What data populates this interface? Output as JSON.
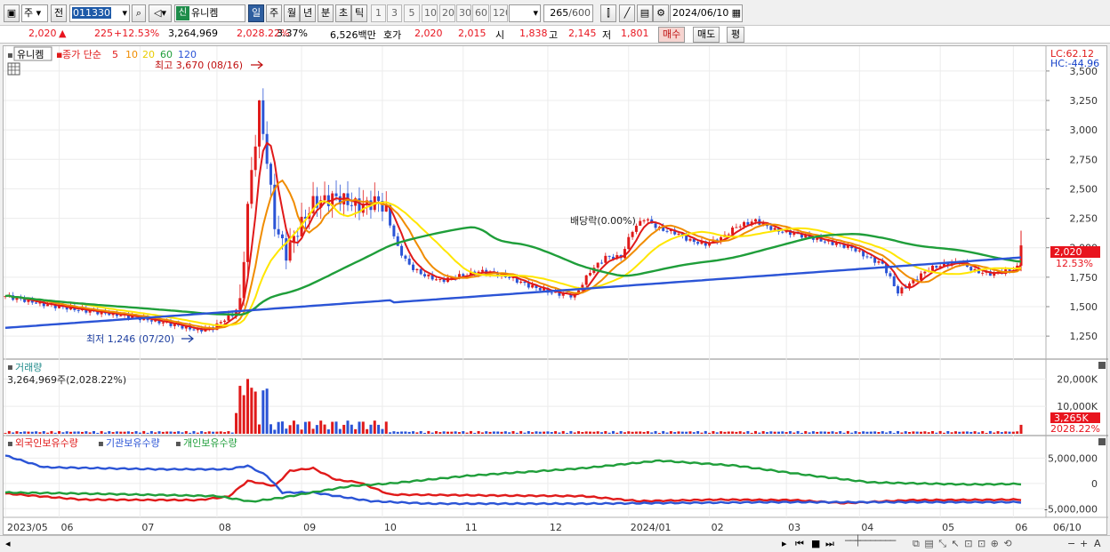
{
  "toolbar": {
    "market": "주",
    "prev_label": "전",
    "code": "011330",
    "badge": "신",
    "stock_name": "유니켐",
    "periods": [
      "일",
      "주",
      "월",
      "년",
      "분",
      "초",
      "틱"
    ],
    "minutes": [
      "1",
      "3",
      "5",
      "10",
      "20",
      "30",
      "60",
      "120"
    ],
    "count": "265",
    "count_total": "/600",
    "date": "2024/06/10"
  },
  "info": {
    "price": "2,020",
    "arrow": "▲",
    "change": "225",
    "change_pct": "+12.53%",
    "volume": "3,264,969",
    "volume_pct": "2,028.22%",
    "turnover": "3.37%",
    "amount": "6,526백만",
    "quote_label": "호가",
    "ask": "2,020",
    "bid": "2,015",
    "open_label": "시",
    "open": "1,838",
    "high_label": "고",
    "high": "2,145",
    "low_label": "저",
    "low": "1,801",
    "buy": "매수",
    "sell": "매도",
    "eval": "평"
  },
  "price_panel": {
    "stock_label": "유니켐",
    "ma_label": "종가 단순",
    "ma_periods": [
      "5",
      "10",
      "20",
      "60",
      "120"
    ],
    "ma_colors": [
      "#e01a1a",
      "#f08c00",
      "#ffe600",
      "#1f9e3a",
      "#2b54d6"
    ],
    "high_marker": "최고 3,670 (08/16)",
    "low_marker": "최저 1,246 (07/20)",
    "dividend": "배당락(0.00%)",
    "lc": "LC:62.12",
    "hc": "HC:-44.96",
    "price_badge": "2,020",
    "pct_badge": "12.53%",
    "y_ticks": [
      "3,500",
      "3,250",
      "3,000",
      "2,750",
      "2,500",
      "2,250",
      "2,000",
      "1,750",
      "1,500",
      "1,250"
    ]
  },
  "volume_panel": {
    "title": "거래량",
    "value": "3,264,969주(2,028.22%)",
    "y_ticks": [
      "20,000K",
      "10,000K"
    ],
    "badge_value": "3,265K",
    "badge_pct": "2028.22%"
  },
  "holding_panel": {
    "legend": [
      "외국인보유수량",
      "기관보유수량",
      "개인보유수량"
    ],
    "legend_colors": [
      "#e01a1a",
      "#2b54d6",
      "#1f9e3a"
    ],
    "y_ticks": [
      "5,000,000",
      "0",
      "-5,000,000"
    ]
  },
  "x_axis": [
    "2023/05",
    "06",
    "07",
    "08",
    "09",
    "10",
    "11",
    "12",
    "2024/01",
    "02",
    "03",
    "04",
    "05",
    "06"
  ],
  "x_axis_right": "06/10",
  "chart_data": {
    "type": "line",
    "title": "유니켐 (011330) 일봉",
    "x": [
      "2023/05",
      "2023/06",
      "2023/07",
      "2023/08",
      "2023/09",
      "2023/10",
      "2023/11",
      "2023/12",
      "2024/01",
      "2024/02",
      "2024/03",
      "2024/04",
      "2024/05",
      "2024/06/10"
    ],
    "series": [
      {
        "name": "종가",
        "values": [
          1560,
          1450,
          1320,
          3200,
          2400,
          2350,
          1700,
          1700,
          2250,
          2080,
          2000,
          1600,
          1820,
          2020
        ]
      },
      {
        "name": "120",
        "values": [
          1330,
          1360,
          1390,
          1480,
          1600,
          1720,
          1760,
          1760,
          1820,
          1860,
          1870,
          1880,
          1900,
          1930
        ]
      }
    ],
    "ylim": [
      1100,
      3650
    ],
    "annotations": [
      "최고 3,670 (08/16)",
      "최저 1,246 (07/20)",
      "배당락(0.00%)"
    ],
    "volume": {
      "last": 3264969,
      "ylim": [
        0,
        20000000
      ]
    },
    "holdings": {
      "ylim": [
        -5000000,
        5000000
      ]
    }
  }
}
